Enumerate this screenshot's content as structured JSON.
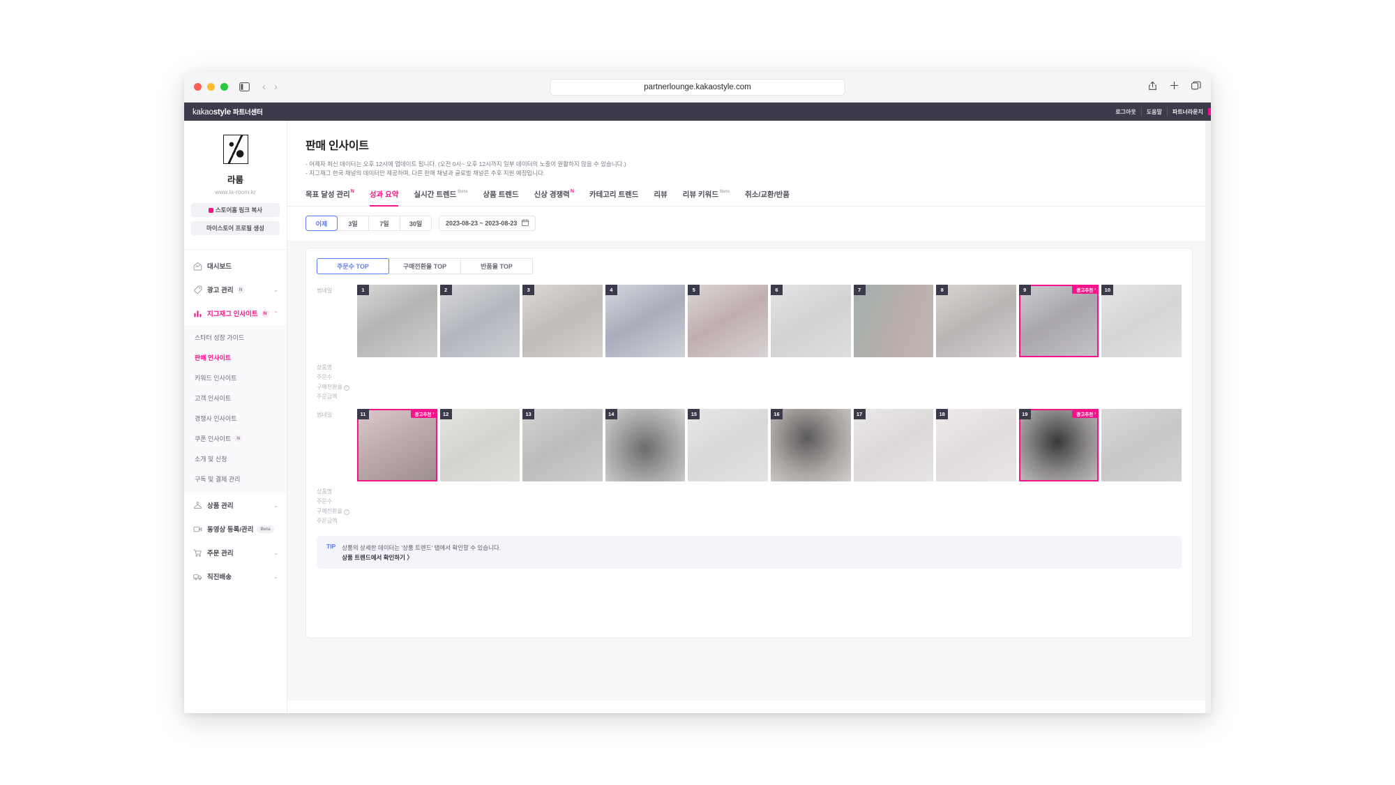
{
  "browser": {
    "url": "partnerlounge.kakaostyle.com",
    "sidebar_toggle_icon": "sidebar-toggle-icon",
    "back_icon": "chevron-left-icon",
    "forward_icon": "chevron-right-icon",
    "share_icon": "share-icon",
    "new_tab_icon": "plus-icon",
    "tabs_icon": "tab-overview-icon"
  },
  "topbar": {
    "brand_light": "kakao",
    "brand_bold": "style",
    "brand_suffix": "파트너센터",
    "links": [
      "로그아웃",
      "도움말",
      "파트너라운지"
    ]
  },
  "sidebar": {
    "shop": {
      "logo_icon": "shop-logo-icon",
      "name": "라룸",
      "url": "www.la-room.kr",
      "copy_link_label": "스토어홈 링크 복사",
      "create_profile_label": "마이스토어 프로필 생성"
    },
    "nav": [
      {
        "label": "대시보드",
        "icon": "home-icon",
        "badge": null,
        "chevron": null,
        "active": false
      },
      {
        "label": "광고 관리",
        "icon": "tag-icon",
        "badge": "N",
        "chevron": "down",
        "active": false
      },
      {
        "label": "지그재그 인사이트",
        "icon": "bar-chart-icon",
        "badge": "N",
        "chevron": "up",
        "active": true
      }
    ],
    "subnav": [
      {
        "label": "스타터 성장 가이드",
        "active": false
      },
      {
        "label": "판매 인사이트",
        "active": true
      },
      {
        "label": "키워드 인사이트",
        "active": false
      },
      {
        "label": "고객 인사이트",
        "active": false
      },
      {
        "label": "경쟁사 인사이트",
        "active": false
      },
      {
        "label": "쿠폰 인사이트",
        "active": false,
        "badge": "N"
      },
      {
        "label": "소개 및 신청",
        "active": false
      },
      {
        "label": "구독 및 결제 관리",
        "active": false
      }
    ],
    "nav_lower": [
      {
        "label": "상품 관리",
        "icon": "hanger-icon",
        "chevron": "down",
        "pill": null
      },
      {
        "label": "동영상 등록/관리",
        "icon": "video-icon",
        "chevron": null,
        "pill": "Beta"
      },
      {
        "label": "주문 관리",
        "icon": "cart-icon",
        "chevron": "down",
        "pill": null
      },
      {
        "label": "직진배송",
        "icon": "truck-icon",
        "chevron": "down",
        "pill": null
      }
    ]
  },
  "page": {
    "title": "판매 인사이트",
    "notes": [
      "- 어제자 최신 데이터는 오후 12시에 업데이트 됩니다. (오전 0시~ 오후 12시까지 일부 데이터의 노출이 원활하지 않을 수 있습니다.)",
      "- 지그재그 한국 채널의 데이터만 제공하며, 다른 판매 채널과 글로벌 채널은 추후 지원 예정입니다."
    ]
  },
  "tabs": [
    {
      "label": "목표 달성 관리",
      "sup": "N",
      "sup_type": "n",
      "active": false
    },
    {
      "label": "성과 요약",
      "sup": null,
      "sup_type": null,
      "active": true
    },
    {
      "label": "실시간 트렌드",
      "sup": "Beta",
      "sup_type": "beta",
      "active": false
    },
    {
      "label": "상품 트렌드",
      "sup": null,
      "sup_type": null,
      "active": false
    },
    {
      "label": "신상 경쟁력",
      "sup": "N",
      "sup_type": "n",
      "active": false
    },
    {
      "label": "카테고리 트렌드",
      "sup": null,
      "sup_type": null,
      "active": false
    },
    {
      "label": "리뷰",
      "sup": null,
      "sup_type": null,
      "active": false
    },
    {
      "label": "리뷰 키워드",
      "sup": "Beta",
      "sup_type": "beta",
      "active": false
    },
    {
      "label": "취소/교환/반품",
      "sup": null,
      "sup_type": null,
      "active": false
    }
  ],
  "filters": {
    "periods": [
      {
        "label": "어제",
        "active": true
      },
      {
        "label": "3일",
        "active": false
      },
      {
        "label": "7일",
        "active": false
      },
      {
        "label": "30일",
        "active": false
      }
    ],
    "date_range": "2023-08-23 ~ 2023-08-23",
    "calendar_icon": "calendar-icon"
  },
  "panel": {
    "rank_tabs": [
      {
        "label": "주문수 TOP",
        "active": true
      },
      {
        "label": "구매전환율 TOP",
        "active": false
      },
      {
        "label": "반품율 TOP",
        "active": false
      }
    ],
    "row_labels": {
      "thumbnail": "썸네일",
      "product_name": "상품명",
      "order_count": "주문수",
      "conversion_rate": "구매전환율",
      "order_amount": "주문금액",
      "info_icon": "info-icon"
    },
    "ad_badge_label": "광고추천",
    "ad_badge_icon": "chevron-right-icon",
    "rows": [
      {
        "items": [
          {
            "rank": "1",
            "ad": false,
            "tone": "#b5b4b2"
          },
          {
            "rank": "2",
            "ad": false,
            "tone": "#b3b6bd"
          },
          {
            "rank": "3",
            "ad": false,
            "tone": "#bfbcb8"
          },
          {
            "rank": "4",
            "ad": false,
            "tone": "#a9adbb"
          },
          {
            "rank": "5",
            "ad": false,
            "tone": "#c0aeae"
          },
          {
            "rank": "6",
            "ad": false,
            "tone": "#d2d2d4"
          },
          {
            "rank": "7",
            "ad": false,
            "tone": "#9fb0ad"
          },
          {
            "rank": "8",
            "ad": false,
            "tone": "#b9b5b4"
          },
          {
            "rank": "9",
            "ad": true,
            "tone": "#a9a6ab"
          },
          {
            "rank": "10",
            "ad": false,
            "tone": "#d6d5d6"
          }
        ]
      },
      {
        "items": [
          {
            "rank": "11",
            "ad": true,
            "tone": "#bca8ab"
          },
          {
            "rank": "12",
            "ad": false,
            "tone": "#d5d3cf"
          },
          {
            "rank": "13",
            "ad": false,
            "tone": "#bdbcba"
          },
          {
            "rank": "14",
            "ad": false,
            "tone": "#a8a7a6"
          },
          {
            "rank": "15",
            "ad": false,
            "tone": "#d9d8d8"
          },
          {
            "rank": "16",
            "ad": false,
            "tone": "#a7a4a2"
          },
          {
            "rank": "17",
            "ad": false,
            "tone": "#dcd9d8"
          },
          {
            "rank": "18",
            "ad": false,
            "tone": "#e0dcde"
          },
          {
            "rank": "19",
            "ad": true,
            "tone": "#8e8b8c"
          },
          {
            "rank": "",
            "ad": false,
            "tone": "#c8c7c6"
          }
        ]
      }
    ]
  },
  "tip": {
    "tag": "TIP",
    "text": "상품의 상세한 데이터는 '상품 트렌드' 탭에서 확인할 수 있습니다.",
    "link": "상품 트렌드에서 확인하기 〉"
  },
  "colors": {
    "brand_pink": "#f5138a",
    "accent_blue": "#5b7cfa",
    "topbar_bg": "#3c3b4b",
    "rank_badge_bg": "#3b3a4b"
  }
}
